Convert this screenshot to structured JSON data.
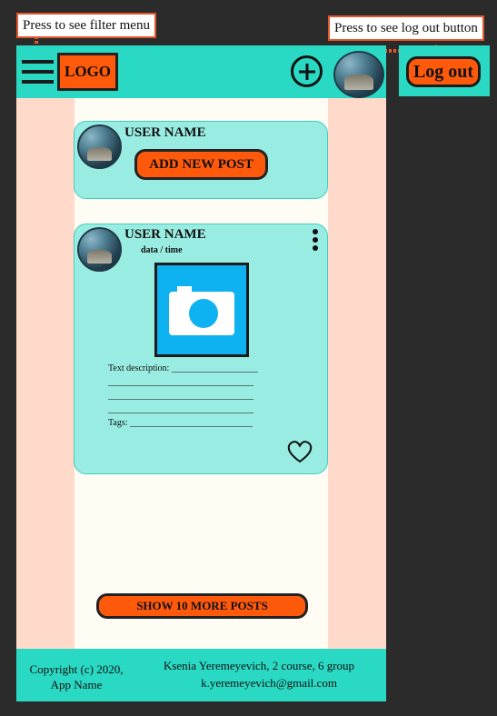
{
  "annotations": {
    "filter_hint": "Press to see filter menu",
    "logout_hint": "Press to see log out button"
  },
  "header": {
    "logo": "LOGO",
    "logout_label": "Log out"
  },
  "new_post_card": {
    "username": "USER NAME",
    "add_post_label": "ADD NEW POST"
  },
  "post": {
    "username": "USER NAME",
    "datetime": "data / time",
    "description_label": "Text description: ___________________",
    "description_lines": [
      "________________________________",
      "________________________________",
      "________________________________"
    ],
    "tags_label": "Tags: ___________________________"
  },
  "more_posts_label": "SHOW 10 MORE POSTS",
  "footer": {
    "copyright_line1": "Copyright (c) 2020,",
    "copyright_line2": "App Name",
    "author_line": "Ksenia Yeremeyevich, 2 course, 6 group",
    "email": "k.yeremeyevich@gmail.com"
  },
  "colors": {
    "background": "#2b2b2b",
    "header": "#2ad9c3",
    "side_panel": "#ffdacb",
    "content": "#fffcf4",
    "card": "#99ece1",
    "button": "#ff5a0c",
    "photo": "#0fb2f0",
    "annotation_border": "#e2572b"
  },
  "icons": [
    "menu-icon",
    "plus-icon",
    "avatar",
    "more-vertical-icon",
    "camera-icon",
    "heart-icon"
  ]
}
